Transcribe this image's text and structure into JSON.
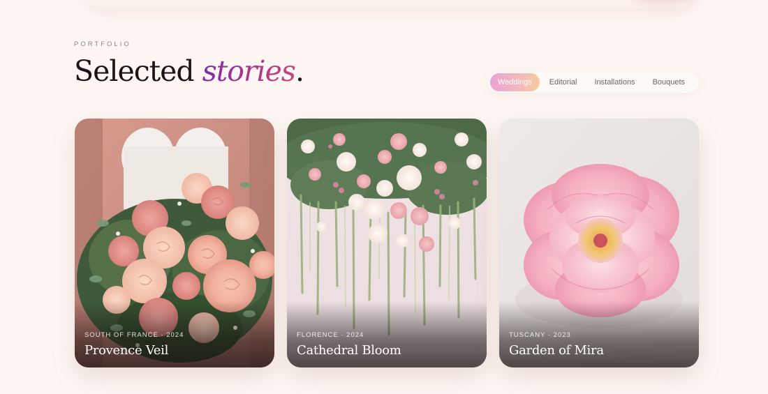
{
  "section": {
    "eyebrow": "PORTFOLIO",
    "title_main": "Selected ",
    "title_accent": "stories",
    "title_end": "."
  },
  "filters": {
    "items": [
      "Weddings",
      "Editorial",
      "Installations",
      "Bouquets"
    ],
    "active": "Weddings"
  },
  "cards": [
    {
      "meta": "SOUTH OF FRANCE · 2024",
      "title": "Provence Veil",
      "image": "bridal-rose-bouquet-image"
    },
    {
      "meta": "FLORENCE · 2024",
      "title": "Cathedral Bloom",
      "image": "hanging-floral-installation-image"
    },
    {
      "meta": "TUSCANY · 2023",
      "title": "Garden of Mira",
      "image": "pink-peony-image"
    }
  ],
  "colors": {
    "background": "#fdf6f2",
    "accent_start": "#7f2da8",
    "accent_end": "#c6457c",
    "chip_gradient_start": "#eaa3d4",
    "chip_gradient_end": "#f8cb9c"
  }
}
